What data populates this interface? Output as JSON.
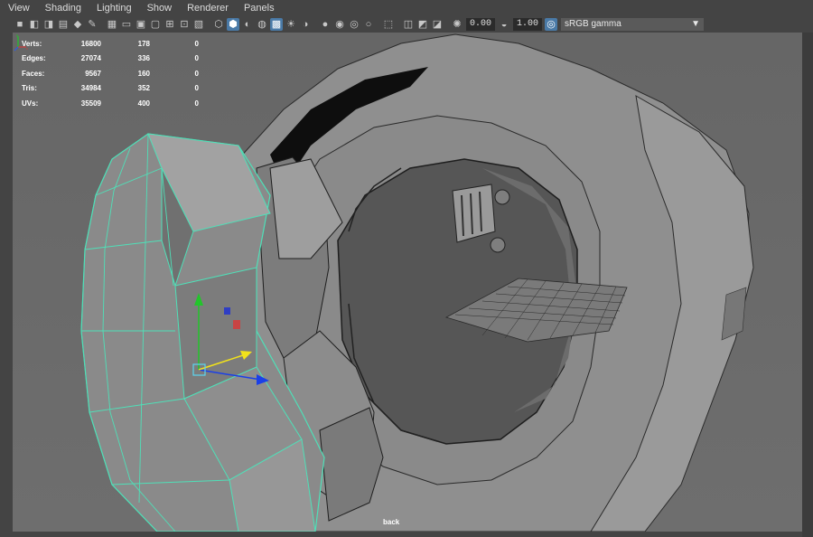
{
  "menu": [
    "View",
    "Shading",
    "Lighting",
    "Show",
    "Renderer",
    "Panels"
  ],
  "toolbar": {
    "exposure_value": "0.00",
    "gamma_value": "1.00",
    "color_space": "sRGB gamma"
  },
  "hud": {
    "rows": [
      {
        "label": "Verts:",
        "v1": "16800",
        "v2": "178",
        "v3": "0"
      },
      {
        "label": "Edges:",
        "v1": "27074",
        "v2": "336",
        "v3": "0"
      },
      {
        "label": "Faces:",
        "v1": "9567",
        "v2": "160",
        "v3": "0"
      },
      {
        "label": "Tris:",
        "v1": "34984",
        "v2": "352",
        "v3": "0"
      },
      {
        "label": "UVs:",
        "v1": "35509",
        "v2": "400",
        "v3": "0"
      }
    ]
  },
  "viewport": {
    "camera_label": "back",
    "selection_color": "#4fe0b8",
    "background_color": "#6b6b6b"
  }
}
